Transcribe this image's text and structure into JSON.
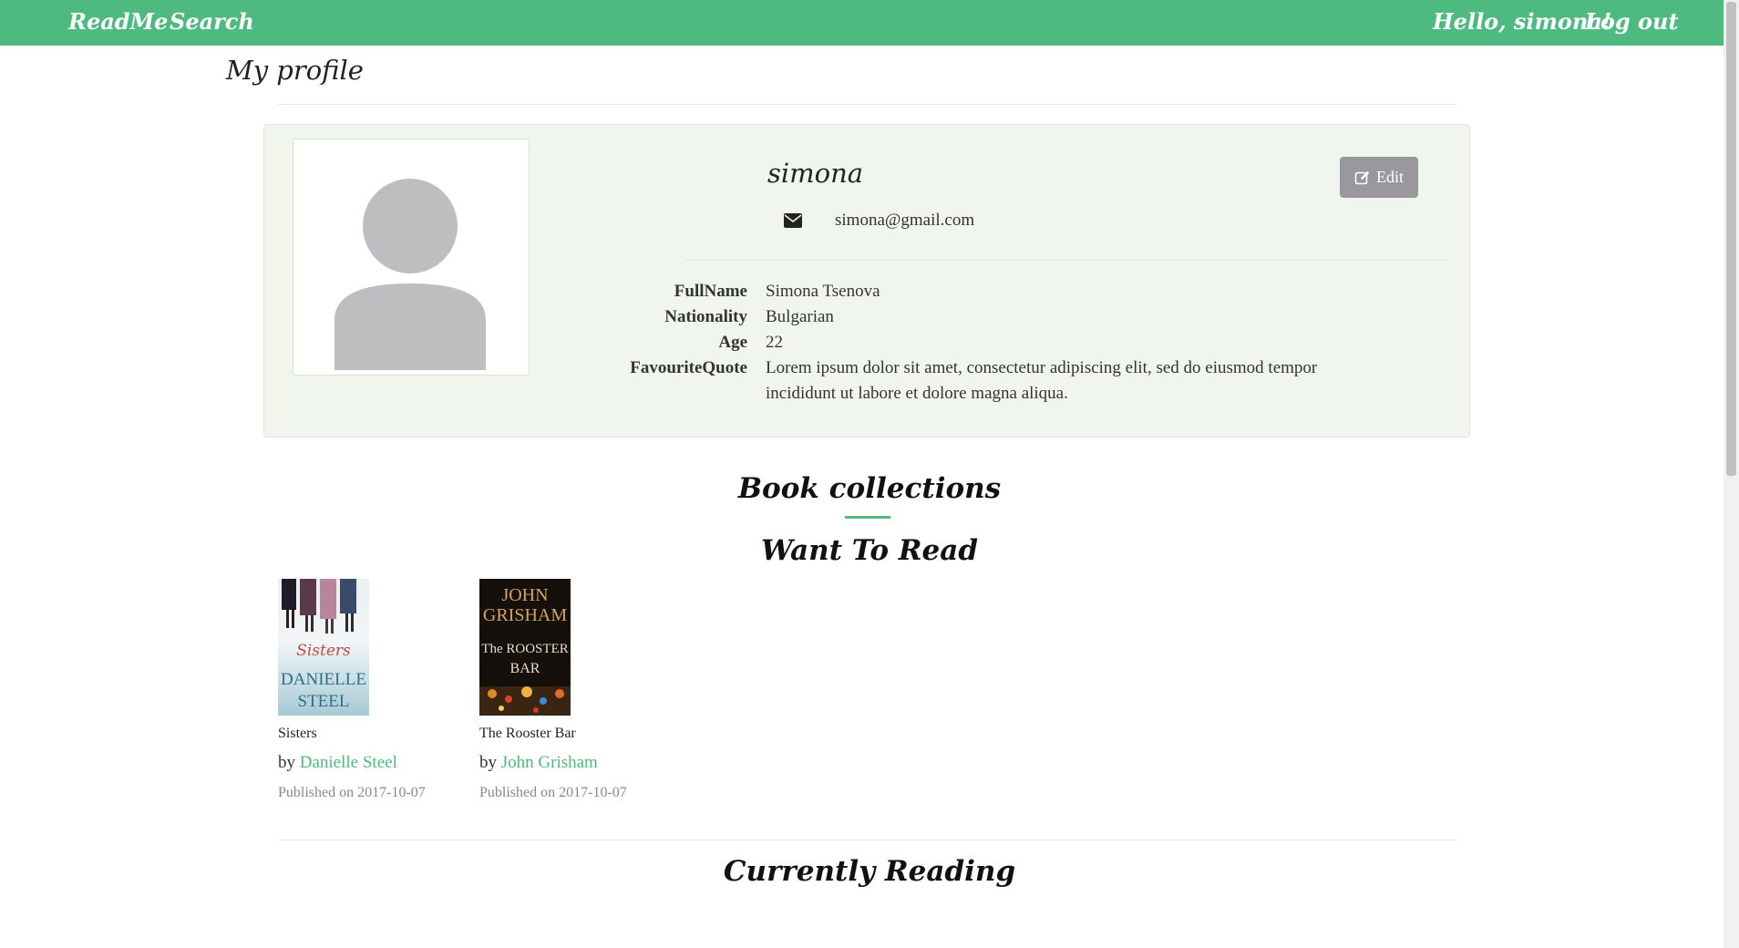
{
  "nav": {
    "brand": "ReadMe",
    "search": "Search",
    "greeting": "Hello, simona!",
    "logout": "Log out"
  },
  "page": {
    "title": "My profile"
  },
  "profile": {
    "username": "simona",
    "email": "simona@gmail.com",
    "edit_label": "Edit",
    "details": [
      {
        "key": "FullName",
        "value": "Simona Tsenova"
      },
      {
        "key": "Nationality",
        "value": "Bulgarian"
      },
      {
        "key": "Age",
        "value": "22"
      },
      {
        "key": "FavouriteQuote",
        "value": "Lorem ipsum dolor sit amet, consectetur adipiscing elit, sed do eiusmod tempor incididunt ut labore et dolore magna aliqua."
      }
    ]
  },
  "collections": {
    "title": "Book collections",
    "want_to_read": {
      "title": "Want To Read",
      "books": [
        {
          "title": "Sisters",
          "by": "by",
          "author": "Danielle Steel",
          "published": "Published on 2017-10-07",
          "cover_text": [
            "Sisters",
            "DANIELLE",
            "STEEL"
          ]
        },
        {
          "title": "The Rooster Bar",
          "by": "by",
          "author": "John Grisham",
          "published": "Published on 2017-10-07",
          "cover_text": [
            "JOHN",
            "GRISHAM",
            "The ROOSTER",
            "BAR"
          ]
        }
      ]
    },
    "currently_reading": {
      "title": "Currently Reading"
    }
  },
  "colors": {
    "accent": "#4fba7f",
    "card_background": "#f0f6ee",
    "edit_button": "#9a989d",
    "avatar_placeholder": "#bdbec0"
  }
}
